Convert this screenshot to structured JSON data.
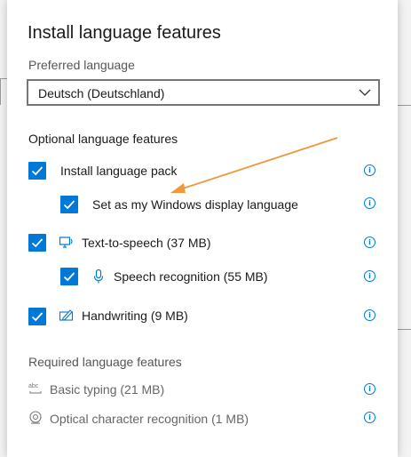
{
  "dialog": {
    "title": "Install language features",
    "preferred_language": {
      "label": "Preferred language",
      "selected": "Deutsch (Deutschland)"
    },
    "optional_section_label": "Optional language features",
    "optional_features": [
      {
        "label": "Install language pack",
        "checked": true,
        "icon": "none"
      },
      {
        "label": "Set as my Windows display language",
        "checked": true,
        "icon": "none"
      },
      {
        "label": "Text-to-speech (37 MB)",
        "checked": true,
        "icon": "monitor-speech-icon"
      },
      {
        "label": "Speech recognition (55 MB)",
        "checked": true,
        "icon": "microphone-icon"
      },
      {
        "label": "Handwriting (9 MB)",
        "checked": true,
        "icon": "pen-icon"
      }
    ],
    "required_section_label": "Required language features",
    "required_features": [
      {
        "label": "Basic typing (21 MB)",
        "icon": "abc-icon"
      },
      {
        "label": "Optical character recognition (1 MB)",
        "icon": "ocr-icon"
      }
    ],
    "info_glyph": "i"
  },
  "colors": {
    "accent": "#0078d7",
    "annotation_arrow": "#f0963c"
  }
}
